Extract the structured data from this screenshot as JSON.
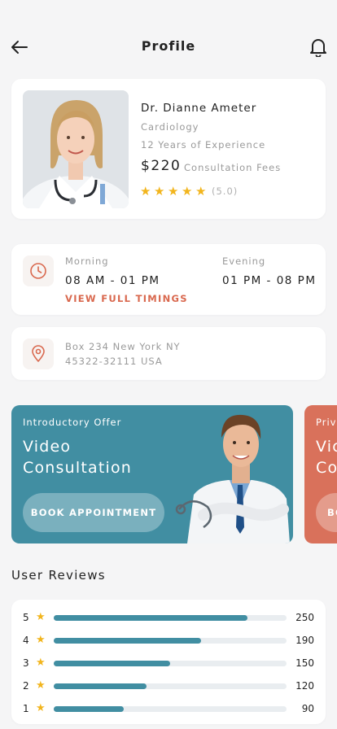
{
  "header": {
    "title": "Profile",
    "back_icon": "arrow-left-icon",
    "bell_icon": "bell-icon"
  },
  "doctor": {
    "name": "Dr. Dianne Ameter",
    "specialty": "Cardiology",
    "experience": "12 Years of Experience",
    "fee": "$220",
    "fee_label": "Consultation Fees",
    "rating_text": "(5.0)",
    "stars": 5
  },
  "timings": {
    "icon": "clock-icon",
    "morning_label": "Morning",
    "morning_value": "08 AM - 01 PM",
    "evening_label": "Evening",
    "evening_value": "01 PM - 08 PM",
    "link": "VIEW FULL TIMINGS"
  },
  "address": {
    "icon": "location-pin-icon",
    "line1": "Box 234 New York NY",
    "line2": "45322-32111 USA"
  },
  "offers": [
    {
      "tag": "Introductory Offer",
      "title_line1": "Video",
      "title_line2": "Consultation",
      "button": "BOOK APPOINTMENT",
      "color": "#418ea2"
    },
    {
      "tag": "Priv",
      "title_line1": "Vic",
      "title_line2": "Co",
      "button": "BO",
      "color": "#d9715b"
    }
  ],
  "reviews": {
    "title": "User Reviews",
    "max": 300,
    "rows": [
      {
        "stars": "5",
        "count": "250",
        "value": 250
      },
      {
        "stars": "4",
        "count": "190",
        "value": 190
      },
      {
        "stars": "3",
        "count": "150",
        "value": 150
      },
      {
        "stars": "2",
        "count": "120",
        "value": 120
      },
      {
        "stars": "1",
        "count": "90",
        "value": 90
      }
    ]
  },
  "colors": {
    "accent": "#418ea2",
    "accent_alt": "#d9715b",
    "star": "#f2b51d",
    "link": "#d9684e"
  }
}
